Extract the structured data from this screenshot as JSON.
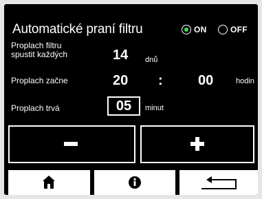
{
  "header": {
    "title": "Automatické praní filtru",
    "on_label": "ON",
    "off_label": "OFF",
    "selected": "ON"
  },
  "settings": {
    "interval": {
      "label_line1": "Proplach filtru",
      "label_line2": "spustit každých",
      "value": "14",
      "unit": "dnů"
    },
    "start": {
      "label": "Proplach začne",
      "hours": "20",
      "separator": ":",
      "minutes": "00",
      "unit": "hodin"
    },
    "duration": {
      "label": "Proplach trvá",
      "value": "05",
      "unit": "minut"
    }
  },
  "buttons": {
    "minus_icon": "minus-icon",
    "plus_icon": "plus-icon"
  },
  "nav": {
    "home_icon": "home-icon",
    "info_icon": "info-icon",
    "back_icon": "back-arrow-icon"
  },
  "colors": {
    "background": "#000000",
    "foreground": "#ffffff",
    "on_indicator": "#3fdc4f",
    "bezel": "#e6e6e6"
  }
}
